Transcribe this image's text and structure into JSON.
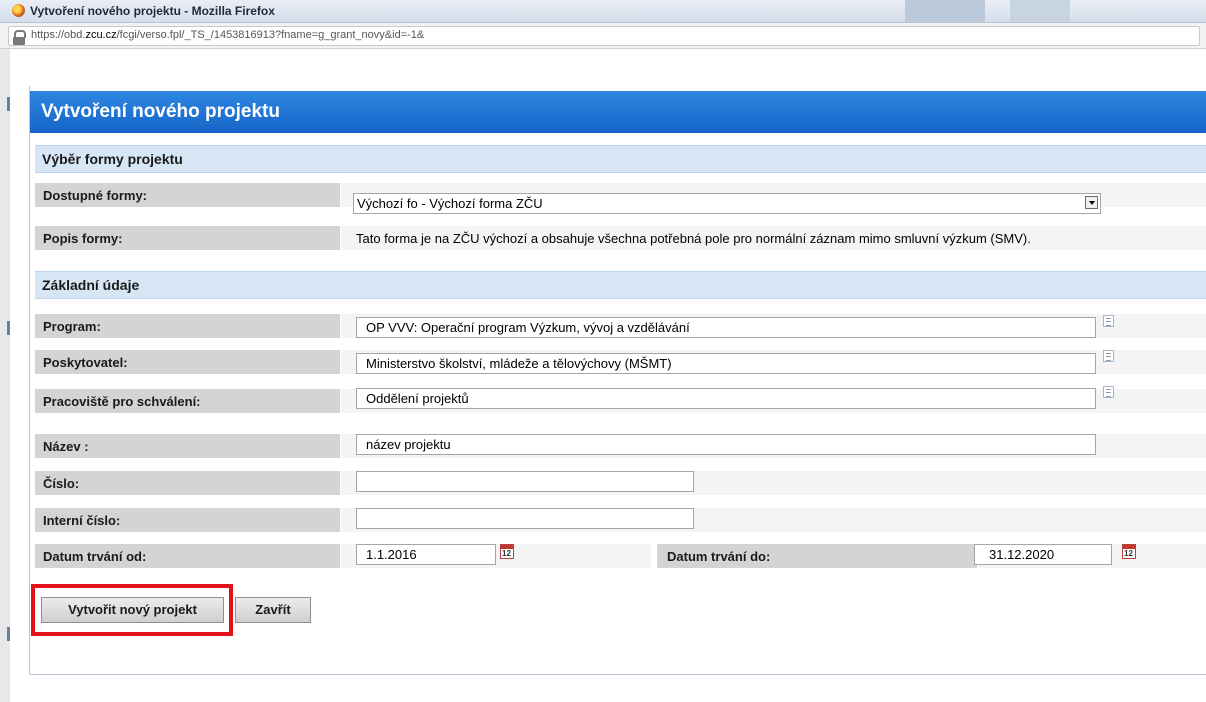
{
  "window": {
    "title": "Vytvoření nového projektu - Mozilla Firefox",
    "url_prefix": "https://obd.",
    "url_domain": "zcu.cz",
    "url_rest": "/fcgi/verso.fpl/_TS_/1453816913?fname=g_grant_novy&id=-1&"
  },
  "dialog": {
    "title": "Vytvoření nového projektu",
    "section_form": "Výběr formy projektu",
    "available_forms_label": "Dostupné formy:",
    "available_forms_value": "Výchozí fo - Výchozí forma ZČU",
    "form_description_label": "Popis formy:",
    "form_description_value": "Tato forma je na ZČU výchozí a obsahuje všechna potřebná pole pro normální záznam mimo smluvní výzkum (SMV).",
    "section_basic": "Základní údaje",
    "program_label": "Program:",
    "program_value": "OP VVV: Operační program Výzkum, vývoj a vzdělávání",
    "provider_label": "Poskytovatel:",
    "provider_value": "Ministerstvo školství, mládeže a tělovýchovy (MŠMT)",
    "workplace_label": "Pracoviště pro schválení:",
    "workplace_value": "Oddělení projektů",
    "name_label": "Název :",
    "name_value": "název projektu",
    "number_label": "Číslo:",
    "number_value": "",
    "internal_number_label": "Interní číslo:",
    "internal_number_value": "",
    "date_from_label": "Datum trvání od:",
    "date_from_value": "1.1.2016",
    "date_to_label": "Datum trvání do:",
    "date_to_value": "31.12.2020",
    "calendar_day": "12",
    "create_button": "Vytvořit nový projekt",
    "close_button": "Zavřít"
  },
  "colors": {
    "header_blue": "#1e74d6",
    "section_bg": "#d6e6f5",
    "label_bg": "#d4d4d4",
    "highlight_red": "#e3131b"
  }
}
